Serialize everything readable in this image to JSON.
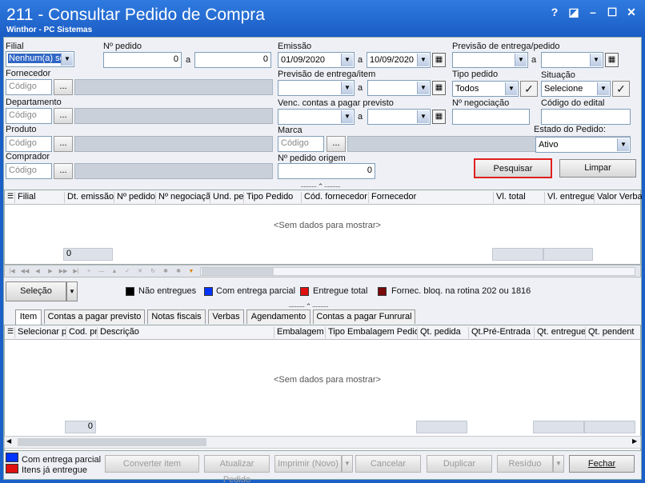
{
  "window": {
    "title": "211 - Consultar Pedido de Compra",
    "subtitle": "Winthor - PC Sistemas",
    "controls": [
      "?",
      "◪",
      "–",
      "☐",
      "✕"
    ]
  },
  "filters": {
    "filial": {
      "label": "Filial",
      "value": "Nenhum(a) se"
    },
    "num_pedido": {
      "label": "Nº pedido",
      "from": "0",
      "to_label": "a",
      "to": "0"
    },
    "emissao": {
      "label": "Emissão",
      "from": "01/09/2020",
      "to_label": "a",
      "to": "10/09/2020"
    },
    "prev_entrega_pedido": {
      "label": "Previsão de entrega/pedido",
      "to_label": "a"
    },
    "fornecedor": {
      "label": "Fornecedor",
      "placeholder": "Código"
    },
    "prev_entrega_item": {
      "label": "Previsão de entrega/item",
      "to_label": "a"
    },
    "tipo_pedido": {
      "label": "Tipo pedido",
      "value": "Todos"
    },
    "situacao": {
      "label": "Situação",
      "value": "Selecione"
    },
    "departamento": {
      "label": "Departamento",
      "placeholder": "Código"
    },
    "venc_contas": {
      "label": "Venc. contas a  pagar previsto",
      "to_label": "a"
    },
    "num_negociacao": {
      "label": "Nº negociação"
    },
    "codigo_edital": {
      "label": "Código do edital"
    },
    "produto": {
      "label": "Produto",
      "placeholder": "Código"
    },
    "marca": {
      "label": "Marca",
      "placeholder": "Código"
    },
    "estado_pedido": {
      "label": "Estado do Pedido:",
      "value": "Ativo"
    },
    "comprador": {
      "label": "Comprador",
      "placeholder": "Código"
    },
    "num_pedido_origem": {
      "label": "Nº pedido origem",
      "value": "0"
    },
    "ellipsis": "...",
    "pesquisar": "Pesquisar",
    "limpar": "Limpar"
  },
  "main_grid": {
    "columns": [
      "Filial",
      "Dt. emissão",
      "Nº pedido",
      "Nº negociaçã",
      "Und. pe",
      "Tipo Pedido",
      "Cód. fornecedor",
      "Fornecedor",
      "Vl. total",
      "Vl. entregue",
      "Valor Verba"
    ],
    "empty_text": "<Sem dados para mostrar>",
    "footer_count": "0"
  },
  "legend": {
    "selecao": "Seleção",
    "items": [
      {
        "label": "Não entregues",
        "color": "#000000"
      },
      {
        "label": "Com entrega parcial",
        "color": "#0033ff"
      },
      {
        "label": "Entregue total",
        "color": "#e01010"
      },
      {
        "label": "Fornec. bloq. na rotina 202 ou 1816",
        "color": "#7a0a0a"
      }
    ]
  },
  "tabs": [
    "Item",
    "Contas a pagar previsto",
    "Notas fiscais",
    "Verbas",
    "Agendamento",
    "Contas a pagar Funrural"
  ],
  "item_grid": {
    "columns": [
      "Selecionar p",
      "Cod. pr",
      "Descrição",
      "Embalagem",
      "Tipo Embalagem Pedido",
      "Qt. pedida",
      "Qt.Pré-Entrada",
      "Qt. entregue",
      "Qt. pendent"
    ],
    "empty_text": "<Sem dados para mostrar>",
    "footer_count": "0"
  },
  "bottom": {
    "legend": [
      {
        "label": "Com entrega parcial",
        "color": "#0033ff"
      },
      {
        "label": "Itens já entregue",
        "color": "#e01010"
      }
    ],
    "buttons": {
      "converter": "Converter item",
      "atualizar": "Atualizar Pedido",
      "imprimir": "Imprimir (Novo)",
      "cancelar": "Cancelar",
      "duplicar": "Duplicar",
      "residuo": "Resíduo",
      "fechar": "Fechar"
    }
  },
  "colors": {
    "title_bar": "#1b60c8",
    "highlight": "#e02020"
  }
}
